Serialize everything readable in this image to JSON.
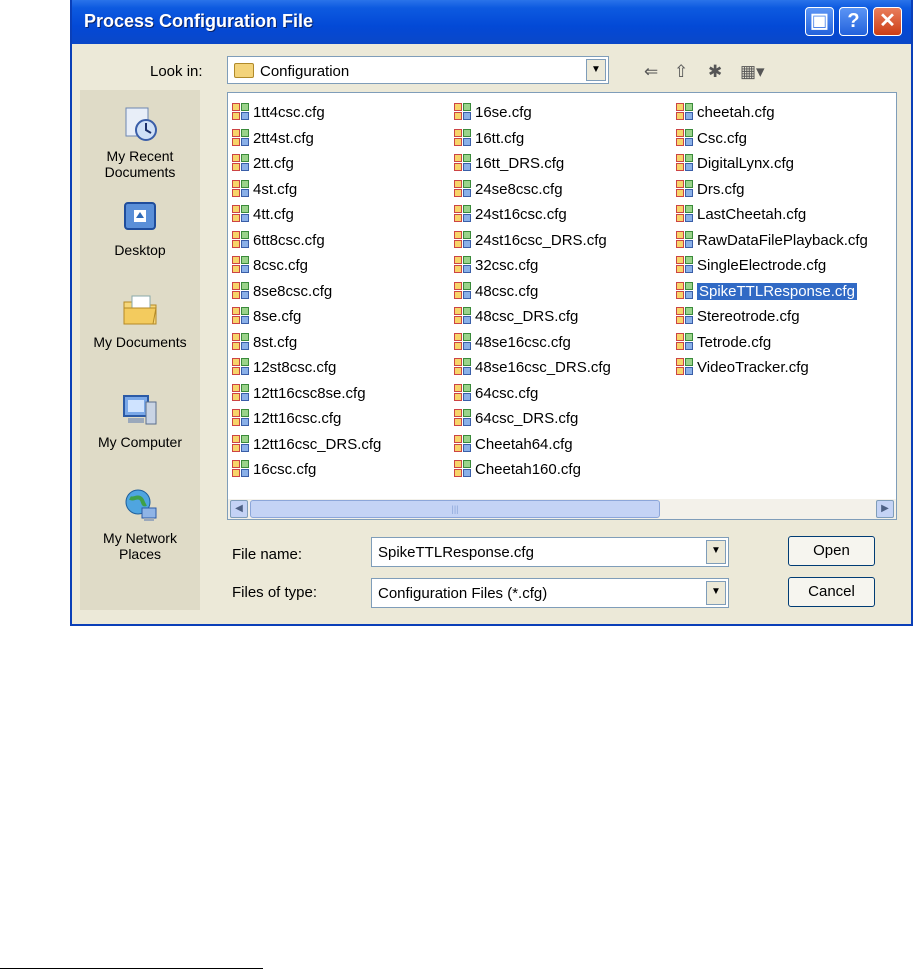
{
  "window": {
    "title": "Process Configuration File"
  },
  "look_in": {
    "label": "Look in:",
    "value": "Configuration"
  },
  "places": [
    {
      "label": "My Recent\nDocuments",
      "icon": "recent-documents-icon"
    },
    {
      "label": "Desktop",
      "icon": "desktop-icon"
    },
    {
      "label": "My Documents",
      "icon": "my-documents-icon"
    },
    {
      "label": "My Computer",
      "icon": "my-computer-icon"
    },
    {
      "label": "My Network\nPlaces",
      "icon": "network-places-icon"
    }
  ],
  "files": [
    [
      "1tt4csc.cfg",
      "2tt4st.cfg",
      "2tt.cfg",
      "4st.cfg",
      "4tt.cfg",
      "6tt8csc.cfg",
      "8csc.cfg",
      "8se8csc.cfg",
      "8se.cfg",
      "8st.cfg",
      "12st8csc.cfg",
      "12tt16csc8se.cfg",
      "12tt16csc.cfg",
      "12tt16csc_DRS.cfg",
      "16csc.cfg"
    ],
    [
      "16se.cfg",
      "16tt.cfg",
      "16tt_DRS.cfg",
      "24se8csc.cfg",
      "24st16csc.cfg",
      "24st16csc_DRS.cfg",
      "32csc.cfg",
      "48csc.cfg",
      "48csc_DRS.cfg",
      "48se16csc.cfg",
      "48se16csc_DRS.cfg",
      "64csc.cfg",
      "64csc_DRS.cfg",
      "Cheetah64.cfg",
      "Cheetah160.cfg"
    ],
    [
      "cheetah.cfg",
      "Csc.cfg",
      "DigitalLynx.cfg",
      "Drs.cfg",
      "LastCheetah.cfg",
      "RawDataFilePlayback.cfg",
      "SingleElectrode.cfg",
      "SpikeTTLResponse.cfg",
      "Stereotrode.cfg",
      "Tetrode.cfg",
      "VideoTracker.cfg"
    ]
  ],
  "selected_file": "SpikeTTLResponse.cfg",
  "file_name": {
    "label": "File name:",
    "value": "SpikeTTLResponse.cfg"
  },
  "file_type": {
    "label": "Files of type:",
    "value": "Configuration Files (*.cfg)"
  },
  "buttons": {
    "open": "Open",
    "cancel": "Cancel"
  },
  "colors": {
    "titlebar": "#0349d6",
    "selection": "#316ac5",
    "dialog_bg": "#ece9d8"
  }
}
